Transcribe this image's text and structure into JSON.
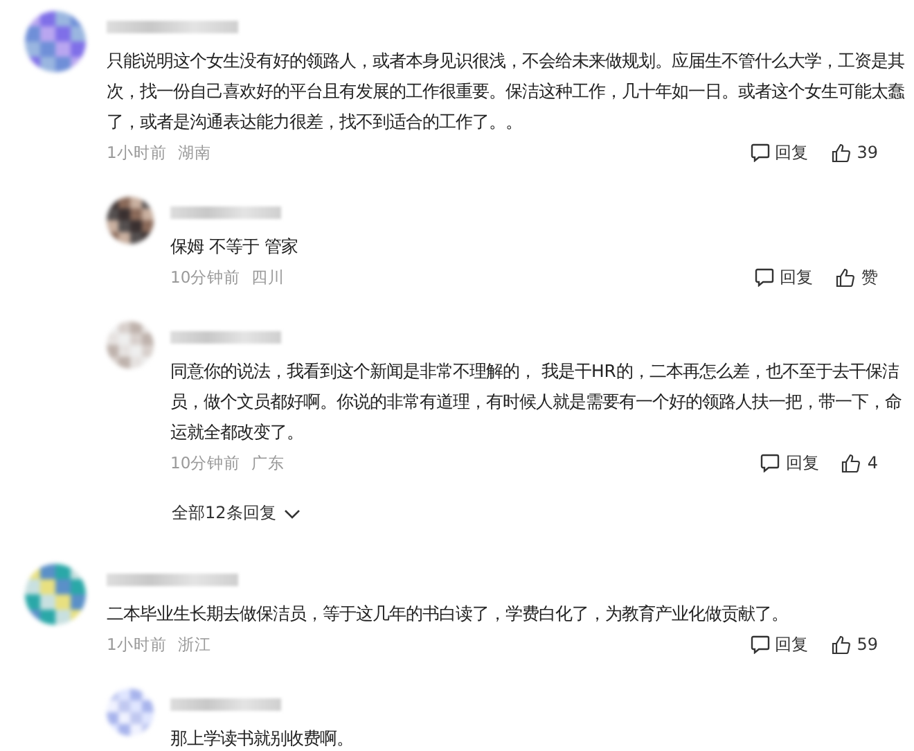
{
  "comments": [
    {
      "text": "只能说明这个女生没有好的领路人，或者本身见识很浅，不会给未来做规划。应届生不管什么大学，工资是其次，找一份自己喜欢好的平台且有发展的工作很重要。保洁这种工作，几十年如一日。或者这个女生可能太蠢了，或者是沟通表达能力很差，找不到适合的工作了。。",
      "time": "1小时前",
      "location": "湖南",
      "reply": "回复",
      "likes": "39",
      "replies": [
        {
          "text": "保姆 不等于 管家",
          "time": "10分钟前",
          "location": "四川",
          "reply": "回复",
          "likes": "赞"
        },
        {
          "text": "同意你的说法，我看到这个新闻是非常不理解的， 我是干HR的，二本再怎么差，也不至于去干保洁员，做个文员都好啊。你说的非常有道理，有时候人就是需要有一个好的领路人扶一把，带一下，命运就全都改变了。",
          "time": "10分钟前",
          "location": "广东",
          "reply": "回复",
          "likes": "4"
        }
      ],
      "more_replies": "全部12条回复"
    },
    {
      "text": "二本毕业生长期去做保洁员，等于这几年的书白读了，学费白化了，为教育产业化做贡献了。",
      "time": "1小时前",
      "location": "浙江",
      "reply": "回复",
      "likes": "59",
      "replies": [
        {
          "text": "那上学读书就别收费啊。"
        }
      ]
    }
  ]
}
